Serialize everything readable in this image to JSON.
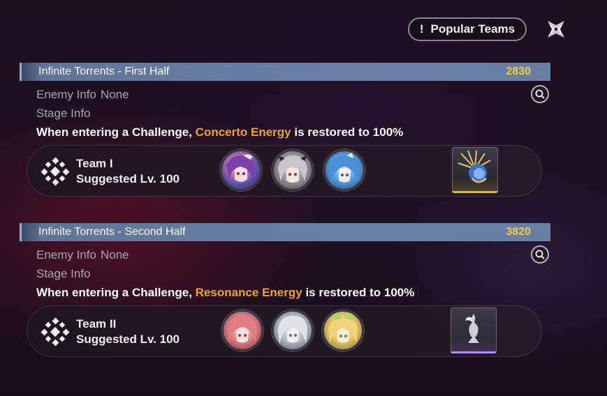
{
  "header": {
    "popular_teams_label": "Popular Teams",
    "popular_teams_mark": "!"
  },
  "stages": [
    {
      "title": "Infinite Torrents - First Half",
      "score": "2830",
      "enemy_info_label": "Enemy Info",
      "enemy_info_value": "None",
      "stage_info_label": "Stage Info",
      "effect_prefix": "When entering a Challenge,",
      "effect_highlight": "Concerto Energy",
      "effect_suffix": "is restored to 100%",
      "team": {
        "name": "Team I",
        "level": "Suggested Lv. 100",
        "portraits": [
          "character-1-portrait",
          "character-2-portrait",
          "character-3-portrait"
        ],
        "echo_icon": "gold-echo-icon"
      }
    },
    {
      "title": "Infinite Torrents - Second Half",
      "score": "3820",
      "enemy_info_label": "Enemy Info",
      "enemy_info_value": "None",
      "stage_info_label": "Stage Info",
      "effect_prefix": "When entering a Challenge,",
      "effect_highlight": "Resonance Energy",
      "effect_suffix": "is restored to 100%",
      "team": {
        "name": "Team II",
        "level": "Suggested Lv. 100",
        "portraits": [
          "character-4-portrait",
          "character-5-portrait",
          "character-6-portrait"
        ],
        "echo_icon": "purple-echo-icon"
      }
    }
  ],
  "colors": {
    "score": "#f2c84c",
    "highlight": "#e9a23a",
    "title_bar": "#6b80a6"
  }
}
